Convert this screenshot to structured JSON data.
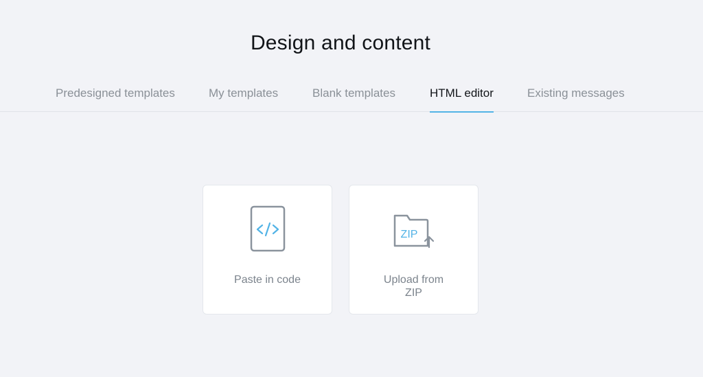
{
  "header": {
    "title": "Design and content"
  },
  "tabs": [
    {
      "label": "Predesigned templates",
      "active": false
    },
    {
      "label": "My templates",
      "active": false
    },
    {
      "label": "Blank templates",
      "active": false
    },
    {
      "label": "HTML editor",
      "active": true
    },
    {
      "label": "Existing messages",
      "active": false
    }
  ],
  "options": [
    {
      "label": "Paste in code",
      "icon": "code-file-icon"
    },
    {
      "label": "Upload from ZIP",
      "icon": "zip-folder-upload-icon",
      "badge": "ZIP"
    }
  ],
  "colors": {
    "background": "#f2f3f7",
    "accent": "#52b3e6",
    "icon_stroke": "#8a939d",
    "tab_text": "#8a9097",
    "tab_active_text": "#111418"
  }
}
